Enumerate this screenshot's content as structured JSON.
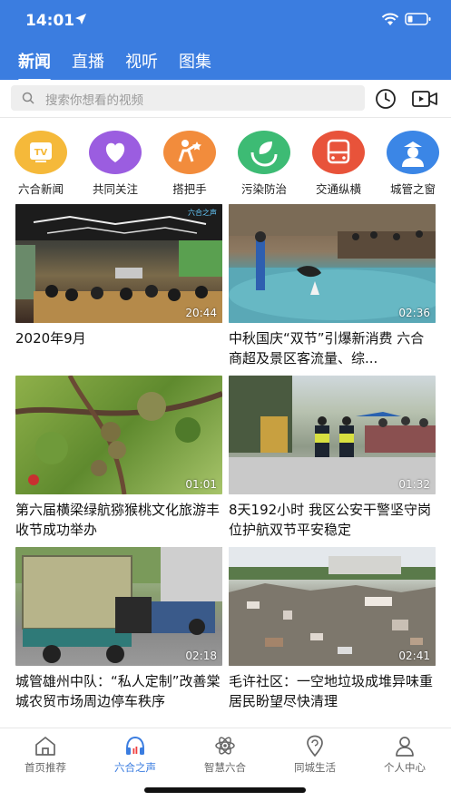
{
  "status_bar": {
    "time": "14:01"
  },
  "top_tabs": [
    {
      "label": "新闻",
      "active": true
    },
    {
      "label": "直播",
      "active": false
    },
    {
      "label": "视听",
      "active": false
    },
    {
      "label": "图集",
      "active": false
    }
  ],
  "search": {
    "placeholder": "搜索你想看的视频"
  },
  "channels": [
    {
      "label": "六合新闻",
      "icon": "tv-icon",
      "color": "#f5b93a"
    },
    {
      "label": "共同关注",
      "icon": "heart-icon",
      "color": "#9b5de0"
    },
    {
      "label": "搭把手",
      "icon": "helper-icon",
      "color": "#f28c3c"
    },
    {
      "label": "污染防治",
      "icon": "eco-icon",
      "color": "#3dbb74"
    },
    {
      "label": "交通纵横",
      "icon": "bus-icon",
      "color": "#e8533a"
    },
    {
      "label": "城管之窗",
      "icon": "officer-icon",
      "color": "#3b86e6"
    }
  ],
  "cards": [
    {
      "title": "2020年9月",
      "duration": "20:44",
      "badge": "六合之声"
    },
    {
      "title": "中秋国庆“双节”引爆新消费 六合商超及景区客流量、综...",
      "duration": "02:36"
    },
    {
      "title": "第六届横梁绿航猕猴桃文化旅游丰收节成功举办",
      "duration": "01:01"
    },
    {
      "title": "8天192小时 我区公安干警坚守岗位护航双节平安稳定",
      "duration": "01:32"
    },
    {
      "title": "城管雄州中队：“私人定制”改善棠城农贸市场周边停车秩序",
      "duration": "02:18"
    },
    {
      "title": "毛许社区：一空地垃圾成堆异味重 居民盼望尽快清理",
      "duration": "02:41"
    }
  ],
  "bottom_nav": [
    {
      "label": "首页推荐",
      "icon": "home-icon",
      "active": false
    },
    {
      "label": "六合之声",
      "icon": "headphones-icon",
      "active": true
    },
    {
      "label": "智慧六合",
      "icon": "atom-icon",
      "active": false
    },
    {
      "label": "同城生活",
      "icon": "location-icon",
      "active": false
    },
    {
      "label": "个人中心",
      "icon": "user-icon",
      "active": false
    }
  ],
  "colors": {
    "brand": "#3b7de0"
  }
}
